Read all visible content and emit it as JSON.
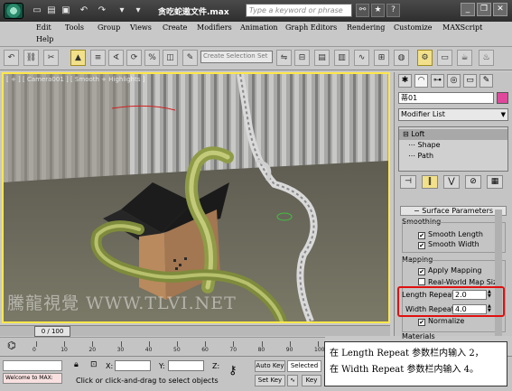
{
  "titlebar": {
    "title": "贪吃蛇遨文件.max",
    "search_placeholder": "Type a keyword or phrase",
    "quick_access_icons": [
      "new-file-icon",
      "open-folder-icon",
      "save-icon",
      "undo-icon",
      "redo-icon"
    ],
    "right_icons": [
      "binoculars-icon",
      "star-icon",
      "help-icon"
    ]
  },
  "menu": {
    "row1": [
      "Edit",
      "Tools",
      "Group",
      "Views",
      "Create",
      "Modifiers",
      "Animation",
      "Graph Editors",
      "Rendering",
      "Customize",
      "MAXScript"
    ],
    "row2": [
      "Help"
    ]
  },
  "toolbar": {
    "selection_set_placeholder": "Create Selection Set",
    "icons": [
      "undo-icon",
      "select-link-icon",
      "unlink-icon",
      "bind-icon",
      "select-object-icon",
      "select-by-name-icon",
      "move-icon",
      "rotate-icon",
      "scale-icon",
      "snap-icon",
      "angle-snap-icon",
      "percent-snap-icon",
      "spinner-snap-icon",
      "named-sets-icon",
      "mirror-icon",
      "align-icon",
      "layers-icon",
      "curve-editor-icon",
      "schematic-icon",
      "material-editor-icon",
      "render-setup-icon",
      "render-frame-icon",
      "render-icon",
      "teapot-icon"
    ]
  },
  "viewport": {
    "label": "[ + ] [ Camera001 ] [ Smooth + Highlights ]",
    "watermark": "騰龍視覺 WWW.TLVI.NET"
  },
  "command_panel": {
    "tabs": [
      "create-icon",
      "modify-icon",
      "hierarchy-icon",
      "motion-icon",
      "display-icon",
      "utilities-icon"
    ],
    "object_name": "蒂01",
    "object_color": "#e0489c",
    "modifier_list": "Modifier List",
    "stack": [
      "Loft",
      "Shape",
      "Path"
    ],
    "stack_tools": [
      "pin-stack-icon",
      "show-end-result-icon",
      "make-unique-icon",
      "remove-modifier-icon",
      "configure-sets-icon"
    ],
    "surface_parameters": {
      "header": "Surface Parameters",
      "smoothing_label": "Smoothing",
      "smooth_length_label": "Smooth Length",
      "smooth_length_checked": "✔",
      "smooth_width_label": "Smooth Width",
      "smooth_width_checked": "✔",
      "mapping_label": "Mapping",
      "apply_mapping_label": "Apply Mapping",
      "apply_mapping_checked": "✔",
      "real_world_label": "Real-World Map Size",
      "length_repeat_label": "Length Repeat:",
      "length_repeat_value": "2.0",
      "width_repeat_label": "Width Repeat:",
      "width_repeat_value": "4.0",
      "normalize_label": "Normalize",
      "normalize_checked": "✔",
      "materials_label": "Materials"
    }
  },
  "timeline": {
    "frame_display": "0 / 100",
    "ticks": [
      "0",
      "10",
      "20",
      "30",
      "40",
      "50",
      "60",
      "70",
      "80",
      "90",
      "100"
    ]
  },
  "statusbar": {
    "maxscript_text": "Welcome to MAX:",
    "x_label": "X:",
    "y_label": "Y:",
    "z_label": "Z:",
    "prompt": "Click or click-and-drag to select objects",
    "auto_key": "Auto Key",
    "set_key": "Set Key",
    "selected": "Selected",
    "key_filters": "Key"
  },
  "callout": {
    "line1": "在 Length Repeat 参数栏内输入 2，",
    "line2": "在 Width Repeat 参数栏内输入 4。"
  }
}
